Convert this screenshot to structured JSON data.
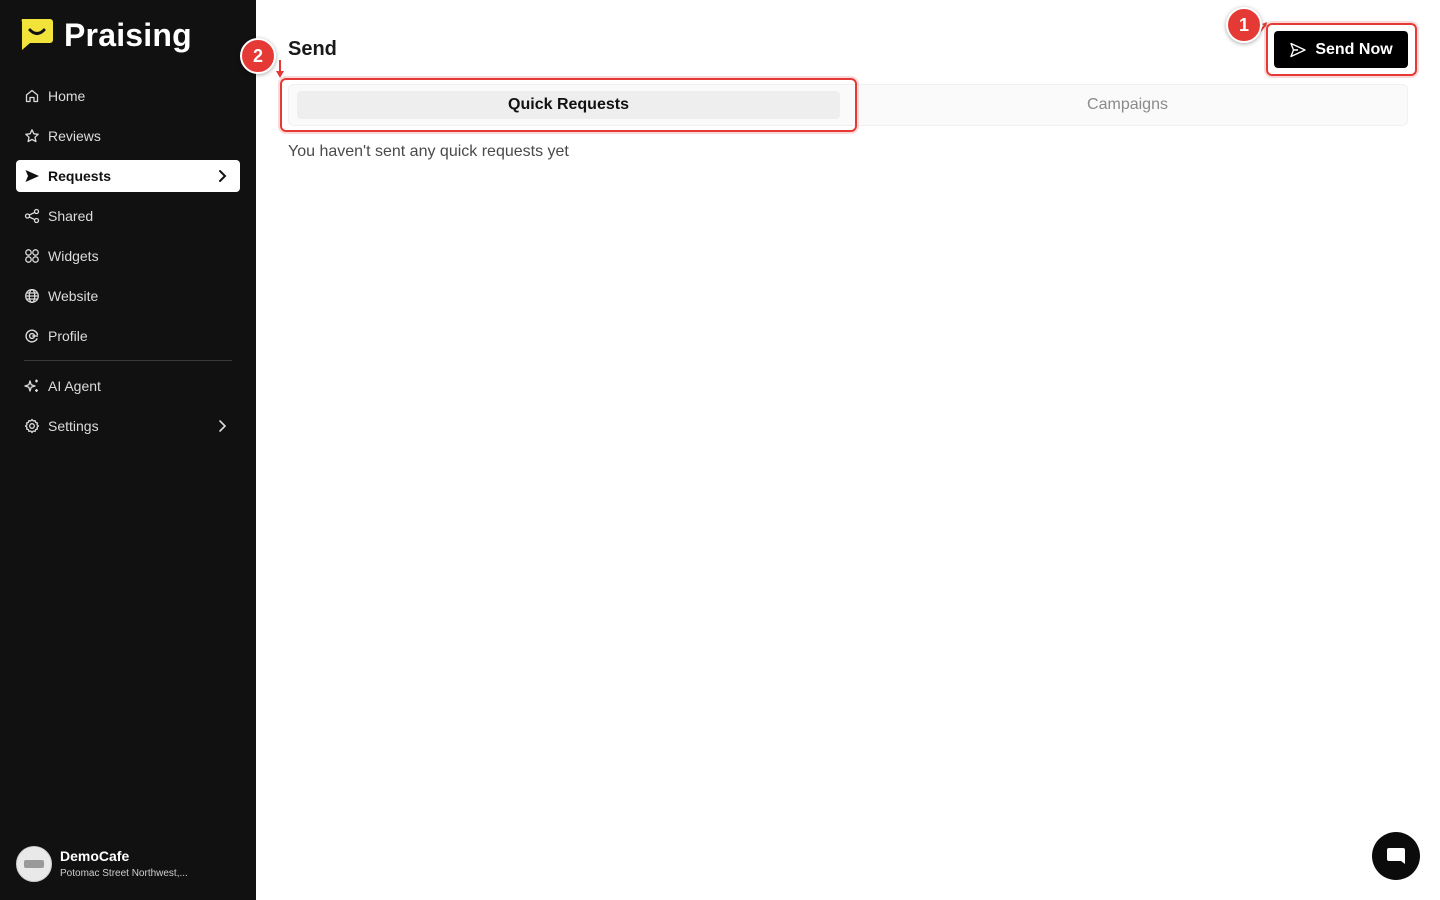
{
  "app": {
    "name": "Praising",
    "brand_color": "#f2e33a"
  },
  "sidebar": {
    "items": [
      {
        "label": "Home",
        "icon": "home-icon"
      },
      {
        "label": "Reviews",
        "icon": "star-icon"
      },
      {
        "label": "Requests",
        "icon": "send-icon",
        "active": true
      },
      {
        "label": "Shared",
        "icon": "share-icon"
      },
      {
        "label": "Widgets",
        "icon": "widgets-icon"
      },
      {
        "label": "Website",
        "icon": "globe-icon"
      },
      {
        "label": "Profile",
        "icon": "google-icon"
      },
      {
        "label": "AI Agent",
        "icon": "sparkle-icon"
      },
      {
        "label": "Settings",
        "icon": "gear-icon"
      }
    ],
    "account": {
      "name": "DemoCafe",
      "address": "Potomac Street Northwest,..."
    }
  },
  "main": {
    "title": "Send",
    "send_button": "Send Now",
    "tabs": [
      {
        "label": "Quick Requests",
        "active": true
      },
      {
        "label": "Campaigns",
        "active": false
      }
    ],
    "empty_message": "You haven't sent any quick requests yet"
  },
  "annotations": {
    "badge_1": "1",
    "badge_2": "2",
    "color": "#e53935"
  }
}
